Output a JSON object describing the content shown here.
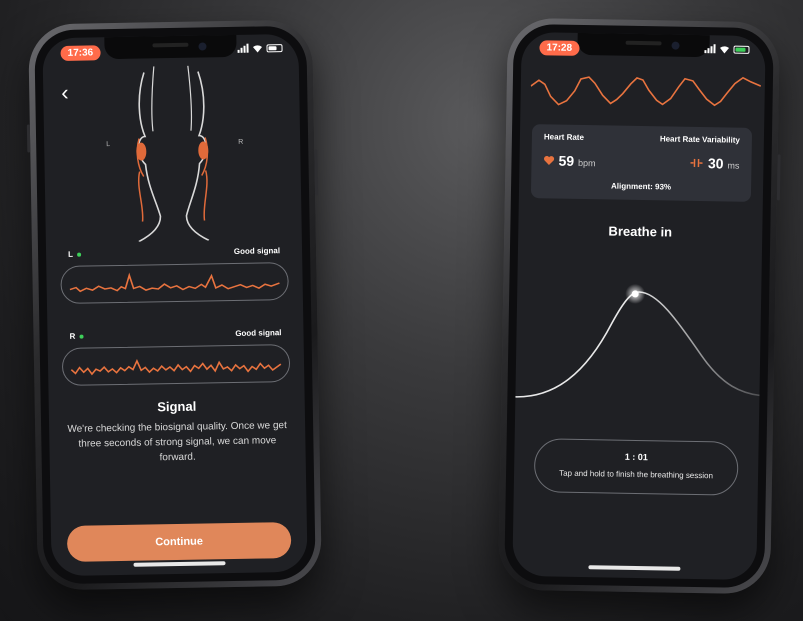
{
  "left_screen": {
    "status_time": "17:36",
    "left_label": "L",
    "right_label": "R",
    "channel_left": {
      "name": "L",
      "status": "Good signal"
    },
    "channel_right": {
      "name": "R",
      "status": "Good signal"
    },
    "title": "Signal",
    "description": "We're checking the biosignal quality. Once we get three seconds of strong signal, we can move forward.",
    "continue_label": "Continue"
  },
  "right_screen": {
    "status_time": "17:28",
    "heart_rate_label": "Heart Rate",
    "heart_rate_value": "59",
    "heart_rate_unit": "bpm",
    "hrv_label": "Heart Rate Variability",
    "hrv_value": "30",
    "hrv_unit": "ms",
    "alignment": "Alignment: 93%",
    "breathe_title": "Breathe in",
    "timer": "1 : 01",
    "hint": "Tap and hold to finish the breathing session"
  },
  "colors": {
    "accent": "#e0875a",
    "status_pill": "#ff6b4a",
    "signal_dot": "#3ecf5a",
    "screen_bg": "#1f2024"
  },
  "icons": {
    "back": "chevron-left-icon",
    "heart": "heart-icon",
    "hrv": "hrv-icon"
  }
}
